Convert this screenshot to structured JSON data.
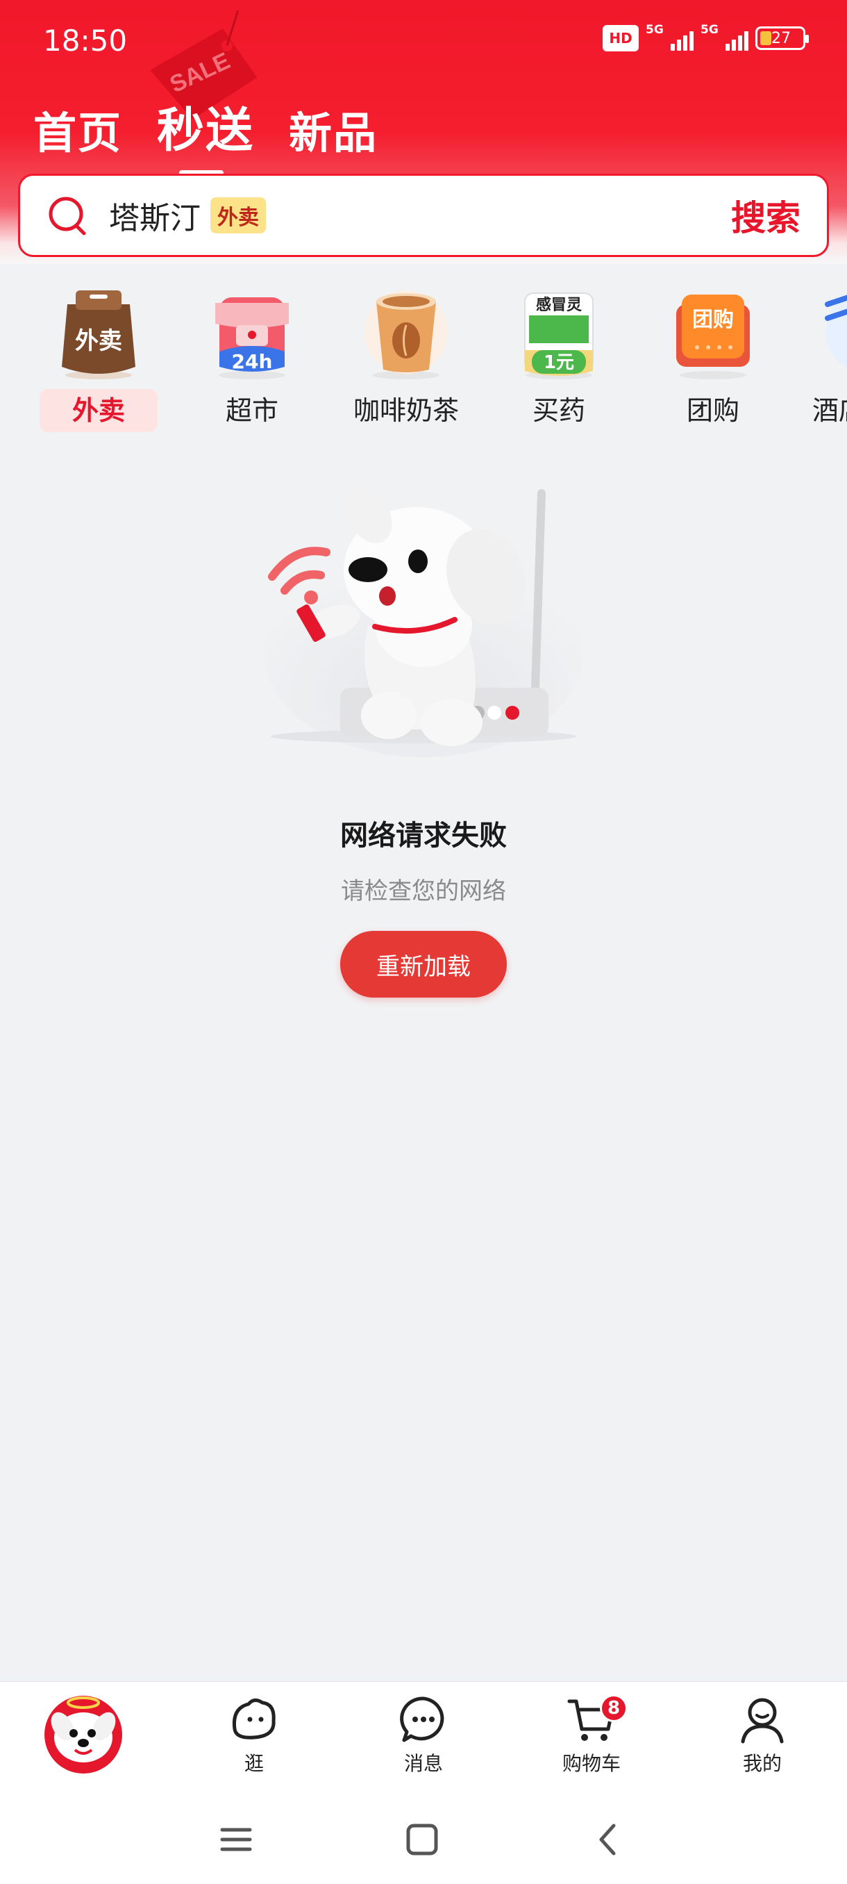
{
  "status": {
    "time": "18:50",
    "hd": "HD",
    "net1": "5G",
    "net2": "5G",
    "battery": "27"
  },
  "header": {
    "tabs": [
      {
        "label": "首页",
        "active": false
      },
      {
        "label": "秒送",
        "active": true
      },
      {
        "label": "新品",
        "active": false
      }
    ],
    "sale_text": "SALE"
  },
  "search": {
    "keyword": "塔斯汀",
    "tag": "外卖",
    "button": "搜索"
  },
  "categories": [
    {
      "label": "外卖",
      "icon_text": "外卖",
      "active": true
    },
    {
      "label": "超市",
      "icon_text": "24h",
      "active": false
    },
    {
      "label": "咖啡奶茶",
      "icon_text": "",
      "active": false
    },
    {
      "label": "买药",
      "icon_text": "感冒灵",
      "icon_sub": "1元",
      "active": false
    },
    {
      "label": "团购",
      "icon_text": "团购",
      "active": false
    },
    {
      "label": "酒店",
      "icon_text": "",
      "active": false
    }
  ],
  "error": {
    "title": "网络请求失败",
    "subtitle": "请检查您的网络",
    "reload": "重新加载"
  },
  "bottom_nav": {
    "items": [
      {
        "label": ""
      },
      {
        "label": "逛"
      },
      {
        "label": "消息"
      },
      {
        "label": "购物车"
      },
      {
        "label": "我的"
      }
    ],
    "cart_count": "8"
  },
  "colors": {
    "brand": "#F0182A",
    "accent": "#E53935",
    "tag_bg": "#FCE38A"
  }
}
